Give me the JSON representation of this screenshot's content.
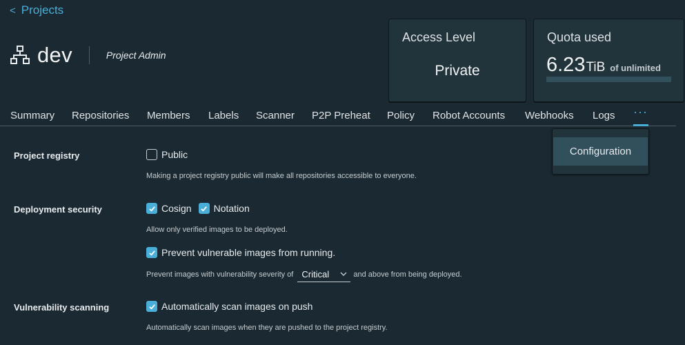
{
  "nav": {
    "back_label": "Projects"
  },
  "project": {
    "name": "dev",
    "role": "Project Admin"
  },
  "cards": {
    "access": {
      "title": "Access Level",
      "value": "Private"
    },
    "quota": {
      "title": "Quota used",
      "value": "6.23",
      "unit": "TiB",
      "of_label": "of unlimited",
      "fill_fraction": 0
    }
  },
  "tabs": [
    "Summary",
    "Repositories",
    "Members",
    "Labels",
    "Scanner",
    "P2P Preheat",
    "Policy",
    "Robot Accounts",
    "Webhooks",
    "Logs",
    "···"
  ],
  "dropdown": {
    "item": "Configuration"
  },
  "settings": {
    "registry": {
      "label": "Project registry",
      "public_label": "Public",
      "public_checked": false,
      "helper": "Making a project registry public will make all repositories accessible to everyone."
    },
    "deployment": {
      "label": "Deployment security",
      "cosign_label": "Cosign",
      "notation_label": "Notation",
      "helper": "Allow only verified images to be deployed.",
      "prevent_label": "Prevent vulnerable images from running.",
      "severity_prefix": "Prevent images with vulnerability severity of",
      "severity_value": "Critical",
      "severity_suffix": "and above from being deployed."
    },
    "scanning": {
      "label": "Vulnerability scanning",
      "auto_label": "Automatically scan images on push",
      "helper": "Automatically scan images when they are pushed to the project registry."
    }
  },
  "colors": {
    "accent": "#49afd9",
    "background": "#1b2a32",
    "card": "#21333b"
  }
}
